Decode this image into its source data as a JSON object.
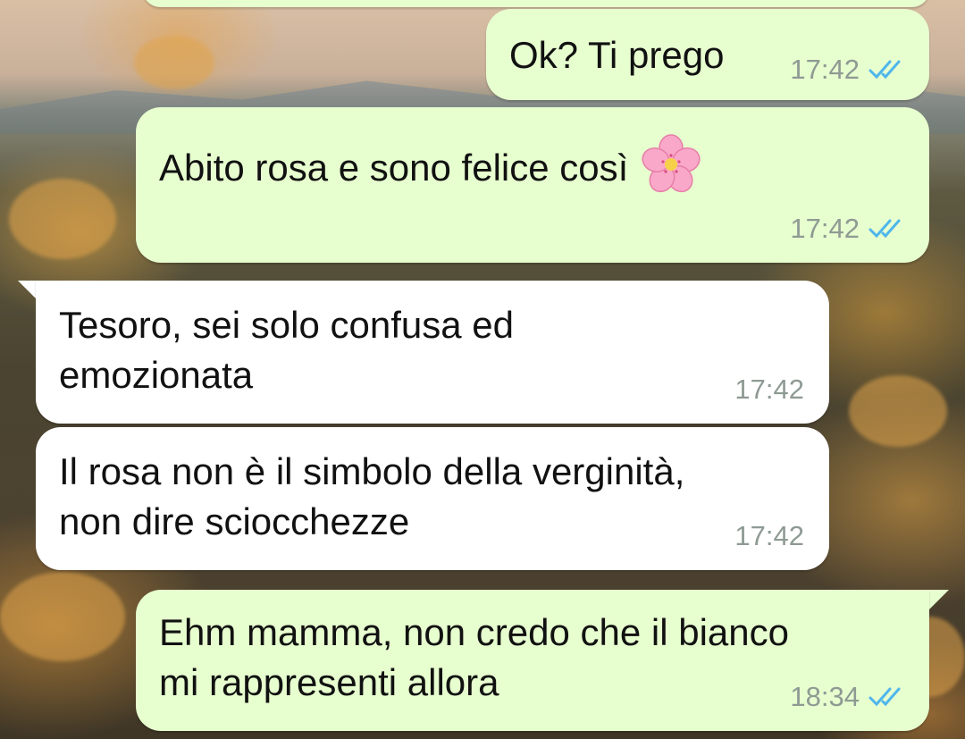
{
  "chat": {
    "messages": [
      {
        "direction": "outgoing",
        "text": "Ok? Ti prego",
        "time": "17:42",
        "status": "read"
      },
      {
        "direction": "outgoing",
        "text": "Abito rosa e sono felice così",
        "emoji": "cherry-blossom-icon",
        "time": "17:42",
        "status": "read"
      },
      {
        "direction": "incoming",
        "lines": [
          "Tesoro, sei solo confusa ed",
          "emozionata"
        ],
        "time": "17:42"
      },
      {
        "direction": "incoming",
        "lines": [
          "Il rosa non è il simbolo della verginità,",
          "non dire sciocchezze"
        ],
        "time": "17:42"
      },
      {
        "direction": "outgoing",
        "lines": [
          "Ehm mamma, non credo che il bianco",
          "mi rappresenti allora"
        ],
        "time": "18:34",
        "status": "read"
      }
    ]
  },
  "colors": {
    "outgoing_bubble": "#e7fecf",
    "incoming_bubble": "#ffffff",
    "read_ticks": "#4fb6ec",
    "timestamp": "#8e9a93"
  }
}
